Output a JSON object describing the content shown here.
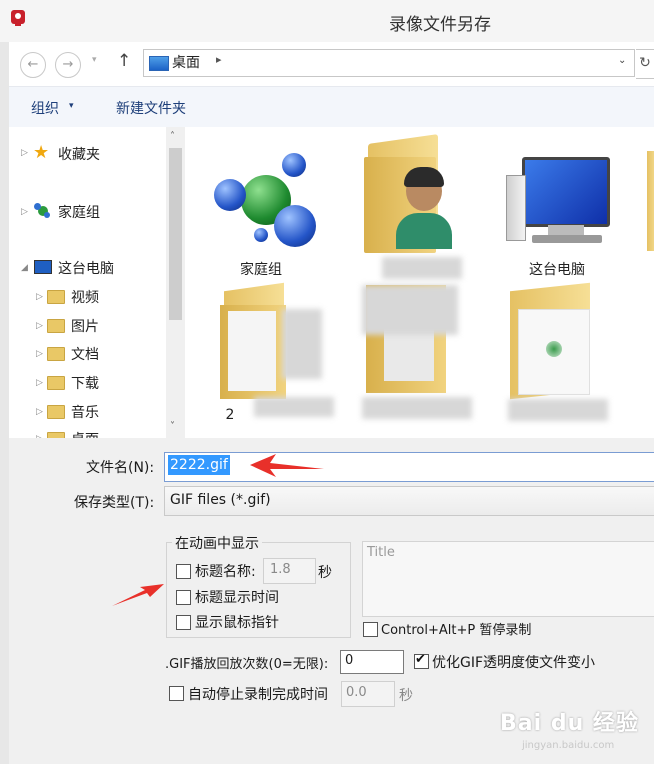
{
  "window": {
    "title": "录像文件另存"
  },
  "address": {
    "location": "桌面",
    "separator": "▸",
    "dropdown": "⌄",
    "refresh": "↻"
  },
  "nav": {
    "back": "←",
    "forward": "→",
    "history_caret": "▾",
    "up": "↑"
  },
  "toolbar": {
    "organize_label": "组织",
    "organize_caret": "▾",
    "new_folder_label": "新建文件夹"
  },
  "sidebar": {
    "scroll_up": "˄",
    "scroll_down": "˅",
    "items": [
      {
        "label": "收藏夹",
        "icon": "star-icon"
      },
      {
        "label": "家庭组",
        "icon": "homegroup-icon"
      },
      {
        "label": "这台电脑",
        "icon": "computer-icon"
      },
      {
        "label": "视频",
        "icon": "videos-folder-icon"
      },
      {
        "label": "图片",
        "icon": "pictures-folder-icon"
      },
      {
        "label": "文档",
        "icon": "documents-folder-icon"
      },
      {
        "label": "下载",
        "icon": "downloads-folder-icon"
      },
      {
        "label": "音乐",
        "icon": "music-folder-icon"
      },
      {
        "label": "桌面",
        "icon": "desktop-folder-icon"
      }
    ]
  },
  "files": [
    {
      "label": "家庭组",
      "icon": "homegroup-icon"
    },
    {
      "label": "",
      "icon": "user-folder-icon"
    },
    {
      "label": "这台电脑",
      "icon": "computer-icon"
    },
    {
      "label": "2",
      "icon": "folder-icon"
    },
    {
      "label": "",
      "icon": "folder-icon"
    },
    {
      "label": "",
      "icon": "folder-icon"
    }
  ],
  "form": {
    "filename_label": "文件名(N):",
    "filename_value": "2222.gif",
    "filetype_label": "保存类型(T):",
    "filetype_value": "GIF files (*.gif)",
    "anim_group_title": "在动画中显示",
    "show_title_label": "标题名称:",
    "show_title_checked": false,
    "title_seconds": "1.8",
    "seconds_unit": "秒",
    "show_title_time_label": "标题显示时间",
    "show_title_time_checked": false,
    "show_cursor_label": "显示鼠标指针",
    "show_cursor_checked": false,
    "title_placeholder": "Title",
    "pause_label": "Control+Alt+P 暂停录制",
    "pause_checked": false,
    "loop_label": ".GIF播放回放次数(0=无限):",
    "loop_value": "0",
    "optimize_label": "优化GIF透明度使文件变小",
    "optimize_checked": true,
    "autostop_label": "自动停止录制完成时间",
    "autostop_checked": false,
    "autostop_value": "0.0",
    "autostop_unit": "秒"
  },
  "watermark": {
    "main": "Bai du 经验",
    "sub": "jingyan.baidu.com"
  },
  "colors": {
    "selection": "#3399ff",
    "annotation_arrow": "#e8302a",
    "link_blue": "#1e3f7a"
  }
}
